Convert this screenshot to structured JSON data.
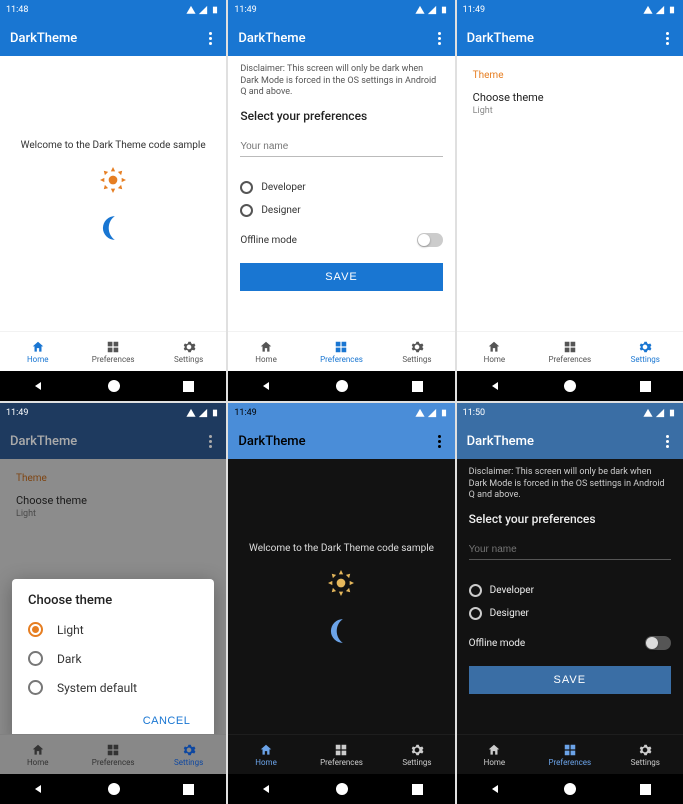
{
  "times": {
    "s1": "11:48",
    "s2": "11:49",
    "s3": "11:49",
    "s4": "11:49",
    "s5": "11:49",
    "s6": "11:50"
  },
  "app_title": "DarkTheme",
  "screen1": {
    "welcome": "Welcome to the Dark Theme code sample"
  },
  "screen2": {
    "disclaimer": "Disclaimer: This screen will only be dark when Dark Mode is forced in the OS settings in Android Q and above.",
    "heading": "Select your preferences",
    "name_placeholder": "Your name",
    "opt_dev": "Developer",
    "opt_des": "Designer",
    "offline_label": "Offline mode",
    "save": "SAVE"
  },
  "screen3": {
    "section": "Theme",
    "item_title": "Choose theme",
    "item_sub": "Light"
  },
  "screen4": {
    "dialog_title": "Choose theme",
    "opt_light": "Light",
    "opt_dark": "Dark",
    "opt_sys": "System default",
    "cancel": "CANCEL",
    "section": "Theme",
    "item_title": "Choose theme",
    "item_sub": "Light"
  },
  "nav": {
    "home": "Home",
    "prefs": "Preferences",
    "settings": "Settings"
  }
}
